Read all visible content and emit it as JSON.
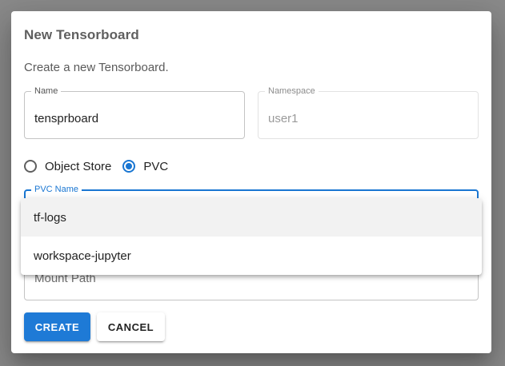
{
  "dialog": {
    "title": "New Tensorboard",
    "subtitle": "Create a new Tensorboard."
  },
  "fields": {
    "name": {
      "label": "Name",
      "value": "tensprboard"
    },
    "namespace": {
      "label": "Namespace",
      "value": "user1"
    },
    "pvc_name": {
      "label": "PVC Name"
    },
    "mount_path": {
      "placeholder": "Mount Path"
    }
  },
  "storage_type": {
    "options": [
      {
        "label": "Object Store",
        "checked": false
      },
      {
        "label": "PVC",
        "checked": true
      }
    ]
  },
  "pvc_dropdown": {
    "options": [
      "tf-logs",
      "workspace-jupyter"
    ],
    "highlighted": "tf-logs"
  },
  "buttons": {
    "create": "CREATE",
    "cancel": "CANCEL"
  },
  "colors": {
    "accent": "#1976d2",
    "backdrop": "#8a8a8a",
    "create_button": "#1e7ad6"
  }
}
